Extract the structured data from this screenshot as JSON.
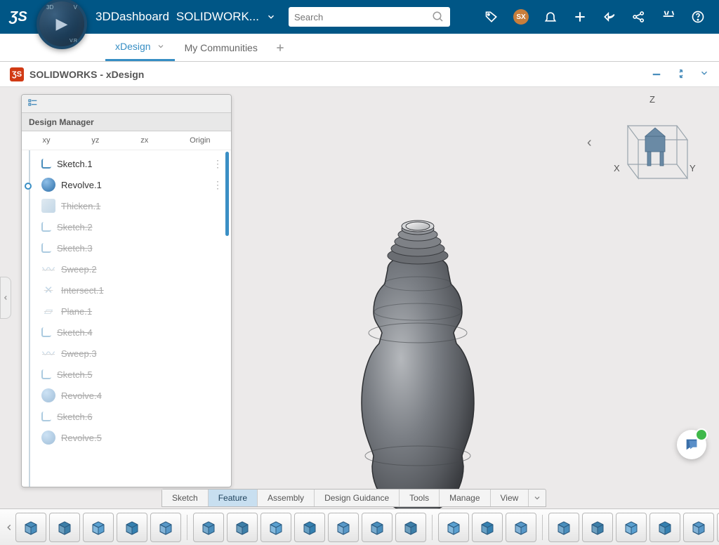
{
  "header": {
    "app_name": "3DDashboard",
    "app_subtitle": "SOLIDWORK...",
    "search_placeholder": "Search",
    "avatar_initials": "SX"
  },
  "tabs": {
    "active": "xDesign",
    "items": [
      "xDesign",
      "My Communities"
    ]
  },
  "panel": {
    "title": "SOLIDWORKS - xDesign"
  },
  "design_manager": {
    "title": "Design Manager",
    "plane_tabs": [
      "xy",
      "yz",
      "zx",
      "Origin"
    ],
    "features": [
      {
        "label": "Sketch.1",
        "icon": "sketch",
        "suppressed": false,
        "menu": true
      },
      {
        "label": "Revolve.1",
        "icon": "revolve",
        "suppressed": false,
        "menu": true,
        "dot": true
      },
      {
        "label": "Thicken.1",
        "icon": "thicken",
        "suppressed": true
      },
      {
        "label": "Sketch.2",
        "icon": "sketch",
        "suppressed": true
      },
      {
        "label": "Sketch.3",
        "icon": "sketch",
        "suppressed": true
      },
      {
        "label": "Sweep.2",
        "icon": "sweep",
        "suppressed": true
      },
      {
        "label": "Intersect.1",
        "icon": "intersect",
        "suppressed": true
      },
      {
        "label": "Plane.1",
        "icon": "plane",
        "suppressed": true
      },
      {
        "label": "Sketch.4",
        "icon": "sketch",
        "suppressed": true
      },
      {
        "label": "Sweep.3",
        "icon": "sweep",
        "suppressed": true
      },
      {
        "label": "Sketch.5",
        "icon": "sketch",
        "suppressed": true
      },
      {
        "label": "Revolve.4",
        "icon": "revolve",
        "suppressed": true
      },
      {
        "label": "Sketch.6",
        "icon": "sketch",
        "suppressed": true
      },
      {
        "label": "Revolve.5",
        "icon": "revolve",
        "suppressed": true
      }
    ]
  },
  "axis_triad": {
    "x": "X",
    "y": "Y",
    "z": "Z"
  },
  "feature_tabs": {
    "items": [
      "Sketch",
      "Feature",
      "Assembly",
      "Design Guidance",
      "Tools",
      "Manage",
      "View"
    ],
    "active": "Feature"
  },
  "toolbar_tools": [
    "extrude",
    "extrude-cut",
    "revolve",
    "sweep",
    "pattern",
    "loft-surface",
    "boundary",
    "fillet",
    "chamfer",
    "draft",
    "shell",
    "rib",
    "hole",
    "thread",
    "mirror",
    "surface-trim",
    "split",
    "move-face",
    "delete-face",
    "replace-face",
    "combine",
    "delete-body"
  ]
}
